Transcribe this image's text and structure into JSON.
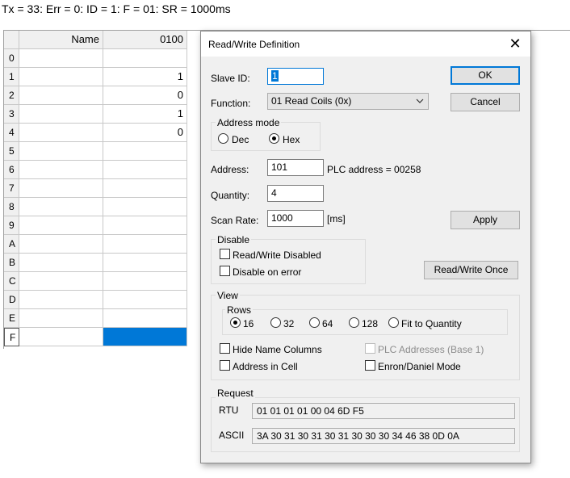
{
  "status_line": "Tx = 33: Err = 0: ID = 1: F = 01: SR = 1000ms",
  "grid": {
    "headers": {
      "name": "Name",
      "address": "0100"
    },
    "rows": [
      {
        "index": "0",
        "value": ""
      },
      {
        "index": "1",
        "value": "1"
      },
      {
        "index": "2",
        "value": "0"
      },
      {
        "index": "3",
        "value": "1"
      },
      {
        "index": "4",
        "value": "0"
      },
      {
        "index": "5",
        "value": ""
      },
      {
        "index": "6",
        "value": ""
      },
      {
        "index": "7",
        "value": ""
      },
      {
        "index": "8",
        "value": ""
      },
      {
        "index": "9",
        "value": ""
      },
      {
        "index": "A",
        "value": ""
      },
      {
        "index": "B",
        "value": ""
      },
      {
        "index": "C",
        "value": ""
      },
      {
        "index": "D",
        "value": ""
      },
      {
        "index": "E",
        "value": ""
      },
      {
        "index": "F",
        "value": ""
      }
    ],
    "selection_color": "#0078d7"
  },
  "dialog": {
    "title": "Read/Write Definition",
    "close_glyph": "✕",
    "slave_id": {
      "label": "Slave ID:",
      "value": "1"
    },
    "function": {
      "label": "Function:",
      "value": "01 Read Coils (0x)"
    },
    "address_mode": {
      "title": "Address mode",
      "dec": "Dec",
      "hex": "Hex",
      "selected": "Hex"
    },
    "address": {
      "label": "Address:",
      "value": "101",
      "plc_address": "PLC address = 00258"
    },
    "quantity": {
      "label": "Quantity:",
      "value": "4"
    },
    "scan_rate": {
      "label": "Scan Rate:",
      "value": "1000",
      "unit": "[ms]"
    },
    "buttons": {
      "ok": "OK",
      "cancel": "Cancel",
      "apply": "Apply",
      "read_write_once": "Read/Write Once"
    },
    "disable": {
      "title": "Disable",
      "rw_disabled": "Read/Write Disabled",
      "on_error": "Disable on error"
    },
    "view": {
      "title": "View",
      "rows_title": "Rows",
      "row_options": [
        "16",
        "32",
        "64",
        "128",
        "Fit to Quantity"
      ],
      "rows_selected": "16",
      "hide_name_columns": "Hide Name Columns",
      "address_in_cell": "Address in Cell",
      "plc_addresses": "PLC Addresses (Base 1)",
      "enron_daniel": "Enron/Daniel Mode"
    },
    "request": {
      "title": "Request",
      "rtu_label": "RTU",
      "rtu_value": "01 01 01 01 00 04 6D F5",
      "ascii_label": "ASCII",
      "ascii_value": "3A 30 31 30 31 30 31 30 30 30 34 46 38 0D 0A"
    },
    "accent_color": "#0078d7"
  }
}
